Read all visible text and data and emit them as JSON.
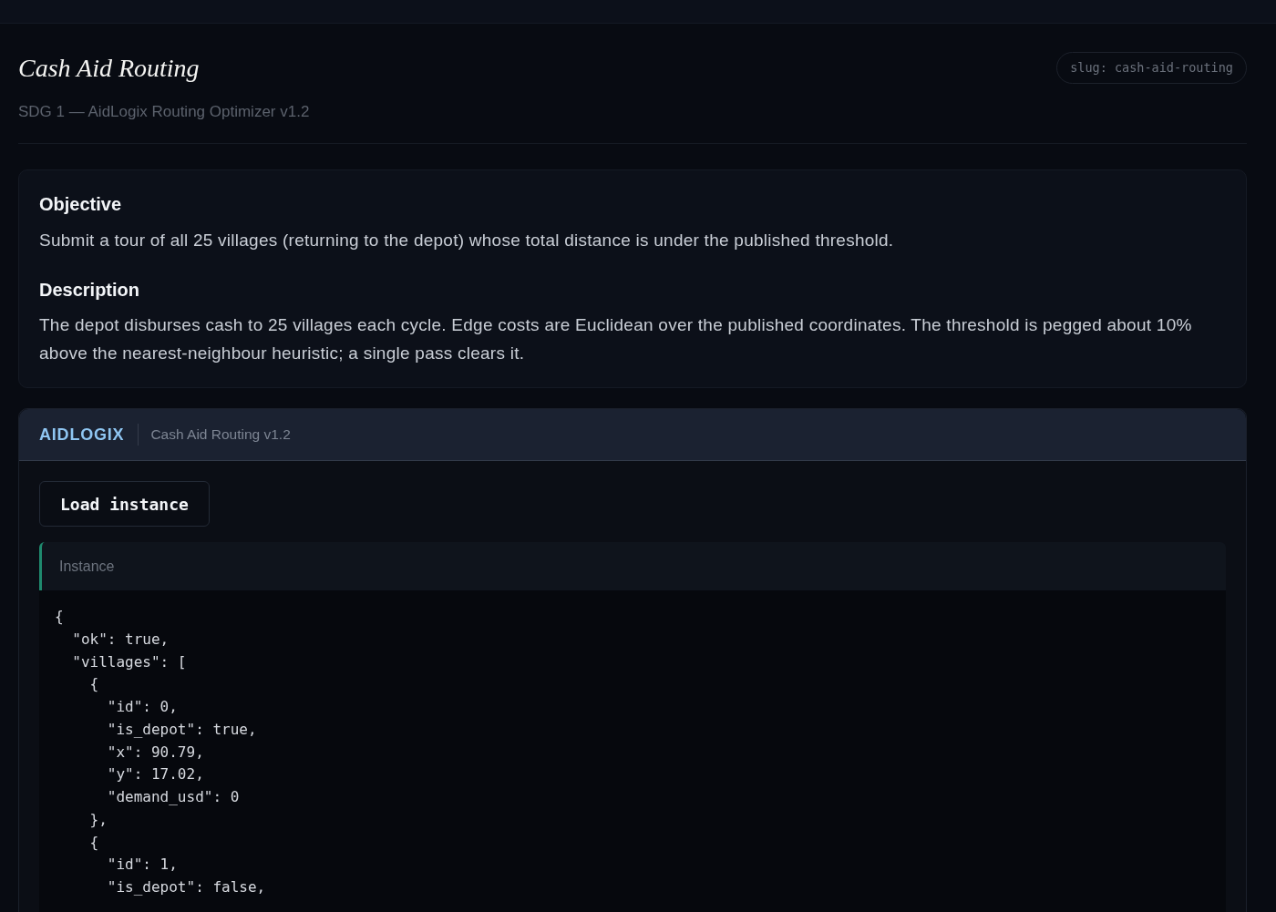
{
  "page": {
    "title": "Cash Aid Routing",
    "subtitle": "SDG 1 — AidLogix Routing Optimizer v1.2",
    "slug": "slug: cash-aid-routing"
  },
  "sections": [
    {
      "heading": "Objective",
      "text": "Submit a tour of all 25 villages (returning to the depot) whose total distance is under the published threshold."
    },
    {
      "heading": "Description",
      "text": "The depot disburses cash to 25 villages each cycle. Edge costs are Euclidean over the published coordinates. The threshold is pegged about 10% above the nearest-neighbour heuristic; a single pass clears it."
    }
  ],
  "widget": {
    "brand": "AIDLOGIX",
    "title": "Cash Aid Routing v1.2",
    "button": "Load instance",
    "output": {
      "label": "Instance",
      "lines": [
        "{",
        "  \"ok\": true,",
        "  \"villages\": [",
        "    {",
        "      \"id\": 0,",
        "      \"is_depot\": true,",
        "      \"x\": 90.79,",
        "      \"y\": 17.02,",
        "      \"demand_usd\": 0",
        "    },",
        "    {",
        "      \"id\": 1,",
        "      \"is_depot\": false,"
      ]
    }
  }
}
